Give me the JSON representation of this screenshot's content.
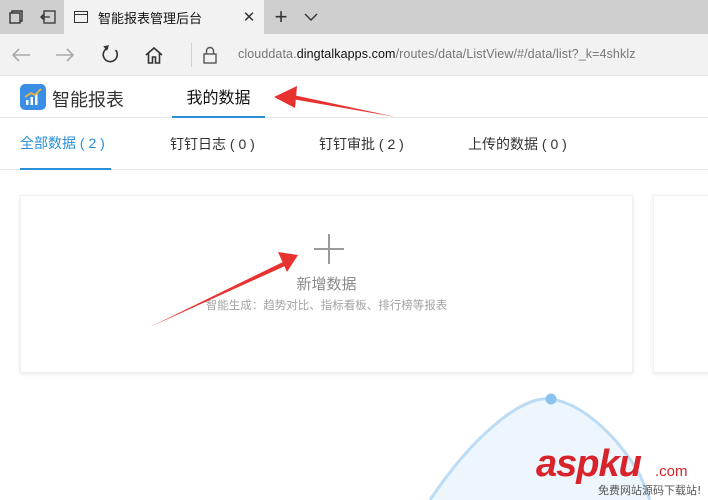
{
  "browser": {
    "tab_title": "智能报表管理后台",
    "tab_close": "✕",
    "new_tab": "+",
    "url_prefix": "clouddata.",
    "url_host": "dingtalkapps.com",
    "url_path": "/routes/data/ListView/#/data/list?_k=4shklz"
  },
  "app": {
    "name": "智能报表",
    "nav_my_data": "我的数据"
  },
  "category_tabs": [
    {
      "label": "全部数据 ( 2 )",
      "active": true
    },
    {
      "label": "钉钉日志 ( 0 )",
      "active": false
    },
    {
      "label": "钉钉审批 ( 2 )",
      "active": false
    },
    {
      "label": "上传的数据 ( 0 )",
      "active": false
    }
  ],
  "new_card": {
    "title": "新增数据",
    "description": "智能生成：趋势对比、指标看板、排行榜等报表"
  },
  "watermark": {
    "main": "aspku",
    "domain": ".com",
    "sub": "免费网站源码下载站!"
  },
  "colors": {
    "accent": "#2b8fd6",
    "annotation_arrow": "#e8322f",
    "watermark": "#d8232a"
  }
}
